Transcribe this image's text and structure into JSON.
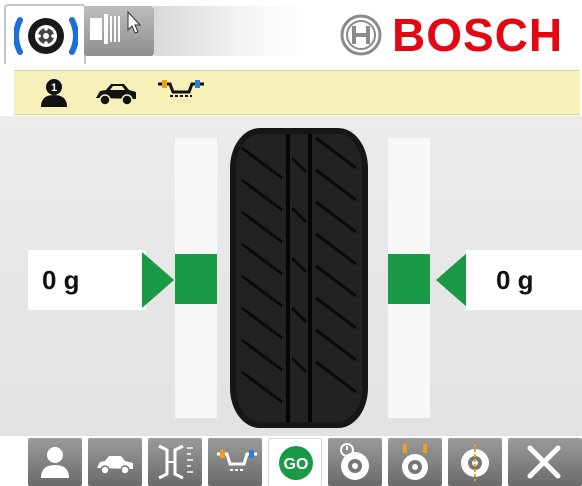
{
  "brand": {
    "name": "BOSCH",
    "color": "#e30613"
  },
  "header": {
    "tabs": [
      {
        "id": "balancing",
        "icon": "tire-wheel-icon",
        "active": true
      },
      {
        "id": "measurement",
        "icon": "gauge-cursor-icon",
        "active": false
      }
    ]
  },
  "status_bar": {
    "icons": [
      "operator-1-icon",
      "vehicle-car-icon",
      "rim-clamp-icon"
    ]
  },
  "balance": {
    "left_imbalance": "0 g",
    "right_imbalance": "0 g",
    "indicator_color": "#1a9a46"
  },
  "toolbar": {
    "buttons": [
      {
        "id": "operator",
        "icon": "person-icon"
      },
      {
        "id": "vehicle",
        "icon": "car-icon"
      },
      {
        "id": "rim-dimensions",
        "icon": "rim-dimensions-icon"
      },
      {
        "id": "balancing-mode",
        "icon": "clamp-weights-icon"
      },
      {
        "id": "go",
        "label": "GO",
        "icon": "go-icon",
        "active": true
      },
      {
        "id": "optimization",
        "icon": "wheel-stopwatch-icon"
      },
      {
        "id": "weight-placement",
        "icon": "wheel-weights-icon"
      },
      {
        "id": "centering",
        "icon": "wheel-center-icon"
      },
      {
        "id": "close",
        "icon": "close-icon"
      }
    ],
    "go_label": "GO"
  }
}
